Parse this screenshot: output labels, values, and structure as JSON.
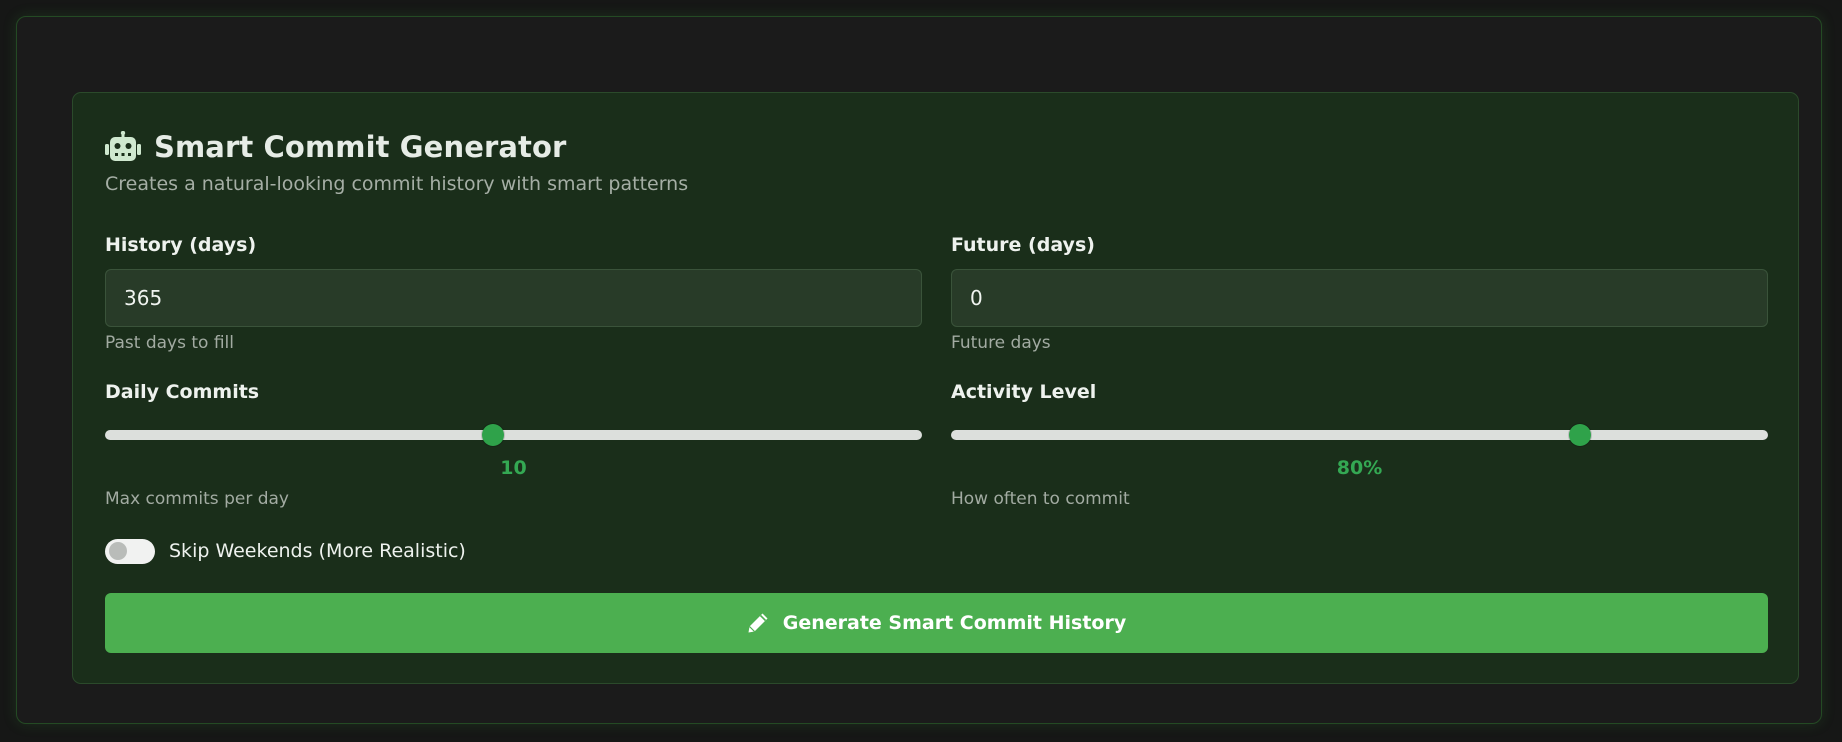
{
  "card": {
    "title": "Smart Commit Generator",
    "subtitle": "Creates a natural-looking commit history with smart patterns",
    "icon": "robot-icon"
  },
  "history": {
    "label": "History (days)",
    "value": "365",
    "hint": "Past days to fill"
  },
  "future": {
    "label": "Future (days)",
    "value": "0",
    "hint": "Future days"
  },
  "daily_commits": {
    "label": "Daily Commits",
    "value_text": "10",
    "fraction": 0.475,
    "hint": "Max commits per day"
  },
  "activity_level": {
    "label": "Activity Level",
    "value_text": "80%",
    "fraction": 0.77,
    "hint": "How often to commit"
  },
  "skip_weekends": {
    "label": "Skip Weekends (More Realistic)",
    "checked": false
  },
  "generate_button": {
    "label": "Generate Smart Commit History",
    "icon": "pencil-icon"
  },
  "colors": {
    "accent": "#4caf50",
    "slider_value": "#34a853",
    "card_bg": "#1a2e1a"
  }
}
